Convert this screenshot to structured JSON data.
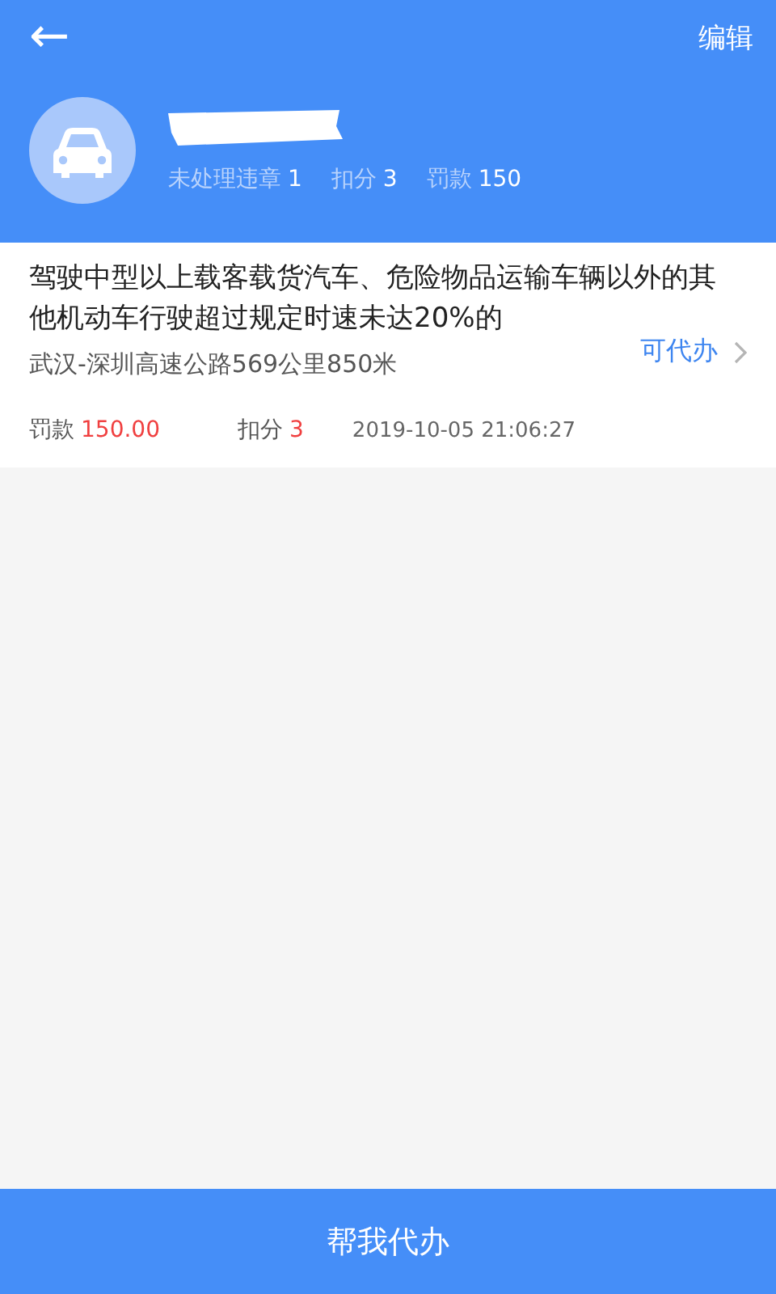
{
  "header": {
    "back": "←",
    "action": "编辑",
    "stats": [
      {
        "label": "未处理违章",
        "value": "1"
      },
      {
        "label": "扣分",
        "value": "3"
      },
      {
        "label": "罚款",
        "value": "150"
      }
    ]
  },
  "violations": [
    {
      "description": "驾驶中型以上载客载货汽车、危险物品运输车辆以外的其他机动车行驶超过规定时速未达20%的",
      "location": "武汉-深圳高速公路569公里850米",
      "status": "可代办",
      "fine_label": "罚款",
      "fine": "150.00",
      "points_label": "扣分",
      "points": "3",
      "time": "2019-10-05 21:06:27"
    }
  ],
  "primary_button": "帮我代办"
}
